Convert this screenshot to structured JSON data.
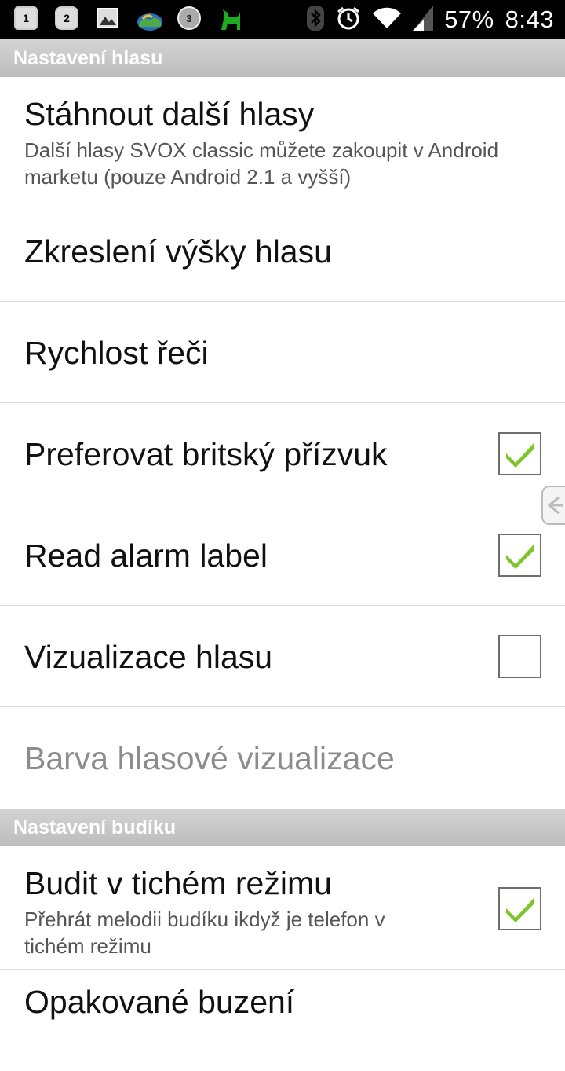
{
  "status_bar": {
    "notif_1_badge": "1",
    "notif_2_badge": "2",
    "notif_3_badge": "3",
    "battery": "57%",
    "time": "8:43",
    "icons": [
      "calendar-icon",
      "sync-icon",
      "gallery-icon",
      "weather-icon",
      "alarm-app-icon",
      "android-app-icon",
      "bluetooth-icon",
      "alarm-icon",
      "wifi-icon",
      "signal-icon"
    ]
  },
  "sections": {
    "voice": {
      "title": "Nastavení hlasu"
    },
    "alarm": {
      "title": "Nastavení budíku"
    }
  },
  "items": {
    "download_voices": {
      "title": "Stáhnout další hlasy",
      "summary": "Další hlasy SVOX classic můžete zakoupit v Android marketu (pouze Android 2.1 a vyšší)"
    },
    "pitch": {
      "title": "Zkreslení výšky hlasu"
    },
    "speed": {
      "title": "Rychlost řeči"
    },
    "british_accent": {
      "title": "Preferovat britský přízvuk",
      "checked": true
    },
    "read_alarm_label": {
      "title": "Read alarm label",
      "checked": true
    },
    "voice_visualization": {
      "title": "Vizualizace hlasu",
      "checked": false
    },
    "visualization_color": {
      "title": "Barva hlasové vizualizace",
      "enabled": false
    },
    "silent_mode_wake": {
      "title": "Budit v tichém režimu",
      "summary": "Přehrát melodii budíku ikdyž je telefon v tichém režimu",
      "checked": true
    },
    "repeated_wake": {
      "title": "Opakované buzení"
    }
  },
  "colors": {
    "check_green": "#7ec52b",
    "header_bg": "#c8c8c8",
    "disabled_text": "#8c8c8c"
  }
}
